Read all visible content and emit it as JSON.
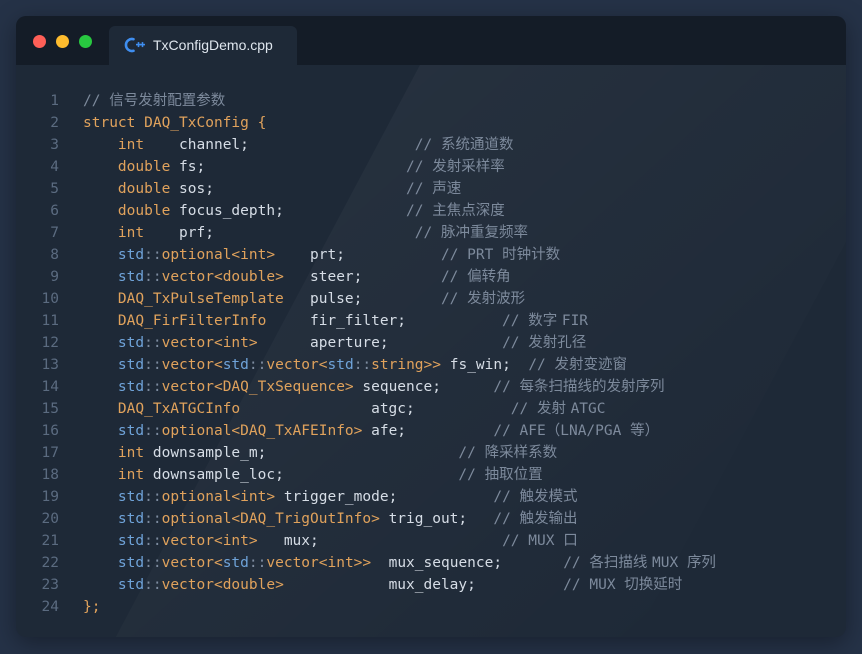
{
  "tab": {
    "filename": "TxConfigDemo.cpp",
    "icon": "cpp-file-icon"
  },
  "window_controls": [
    "close",
    "minimize",
    "maximize"
  ],
  "colors": {
    "keyword": "#e0a25c",
    "namespace": "#6fa3d9",
    "comment": "#7d8a9c",
    "text": "#d6dde6",
    "background": "#1e2937"
  },
  "lines": [
    {
      "n": "1",
      "tokens": [
        [
          "c",
          "// "
        ],
        [
          "cn",
          "信号发射配置参数"
        ]
      ]
    },
    {
      "n": "2",
      "tokens": [
        [
          "k",
          "struct DAQ_TxConfig {"
        ]
      ]
    },
    {
      "n": "3",
      "tokens": [
        [
          "x",
          "    "
        ],
        [
          "k",
          "int"
        ],
        [
          "x",
          "    channel;                   "
        ],
        [
          "c",
          "// "
        ],
        [
          "cn",
          "系统通道数"
        ]
      ]
    },
    {
      "n": "4",
      "tokens": [
        [
          "x",
          "    "
        ],
        [
          "k",
          "double"
        ],
        [
          "x",
          " fs;                       "
        ],
        [
          "c",
          "// "
        ],
        [
          "cn",
          "发射采样率"
        ]
      ]
    },
    {
      "n": "5",
      "tokens": [
        [
          "x",
          "    "
        ],
        [
          "k",
          "double"
        ],
        [
          "x",
          " sos;                      "
        ],
        [
          "c",
          "// "
        ],
        [
          "cn",
          "声速"
        ]
      ]
    },
    {
      "n": "6",
      "tokens": [
        [
          "x",
          "    "
        ],
        [
          "k",
          "double"
        ],
        [
          "x",
          " focus_depth;              "
        ],
        [
          "c",
          "// "
        ],
        [
          "cn",
          "主焦点深度"
        ]
      ]
    },
    {
      "n": "7",
      "tokens": [
        [
          "x",
          "    "
        ],
        [
          "k",
          "int"
        ],
        [
          "x",
          "    prf;                       "
        ],
        [
          "c",
          "// "
        ],
        [
          "cn",
          "脉冲重复频率"
        ]
      ]
    },
    {
      "n": "8",
      "tokens": [
        [
          "x",
          "    "
        ],
        [
          "ns",
          "std"
        ],
        [
          "p",
          "::"
        ],
        [
          "k",
          "optional<int>"
        ],
        [
          "x",
          "    prt;           "
        ],
        [
          "c",
          "// "
        ],
        [
          "c",
          "PRT "
        ],
        [
          "cn",
          "时钟计数"
        ]
      ]
    },
    {
      "n": "9",
      "tokens": [
        [
          "x",
          "    "
        ],
        [
          "ns",
          "std"
        ],
        [
          "p",
          "::"
        ],
        [
          "k",
          "vector<double>"
        ],
        [
          "x",
          "   steer;         "
        ],
        [
          "c",
          "// "
        ],
        [
          "cn",
          "偏转角"
        ]
      ]
    },
    {
      "n": "10",
      "tokens": [
        [
          "x",
          "    "
        ],
        [
          "k",
          "DAQ_TxPulseTemplate"
        ],
        [
          "x",
          "   pulse;         "
        ],
        [
          "c",
          "// "
        ],
        [
          "cn",
          "发射波形"
        ]
      ]
    },
    {
      "n": "11",
      "tokens": [
        [
          "x",
          "    "
        ],
        [
          "k",
          "DAQ_FirFilterInfo"
        ],
        [
          "x",
          "     fir_filter;           "
        ],
        [
          "c",
          "// "
        ],
        [
          "cn",
          "数字 "
        ],
        [
          "c",
          "FIR"
        ]
      ]
    },
    {
      "n": "12",
      "tokens": [
        [
          "x",
          "    "
        ],
        [
          "ns",
          "std"
        ],
        [
          "p",
          "::"
        ],
        [
          "k",
          "vector<int>"
        ],
        [
          "x",
          "      aperture;             "
        ],
        [
          "c",
          "// "
        ],
        [
          "cn",
          "发射孔径"
        ]
      ]
    },
    {
      "n": "13",
      "tokens": [
        [
          "x",
          "    "
        ],
        [
          "ns",
          "std"
        ],
        [
          "p",
          "::"
        ],
        [
          "k",
          "vector<"
        ],
        [
          "ns",
          "std"
        ],
        [
          "p",
          "::"
        ],
        [
          "k",
          "vector<"
        ],
        [
          "ns",
          "std"
        ],
        [
          "p",
          "::"
        ],
        [
          "k",
          "string>>"
        ],
        [
          "x",
          " fs_win;  "
        ],
        [
          "c",
          "// "
        ],
        [
          "cn",
          "发射变迹窗"
        ]
      ]
    },
    {
      "n": "14",
      "tokens": [
        [
          "x",
          "    "
        ],
        [
          "ns",
          "std"
        ],
        [
          "p",
          "::"
        ],
        [
          "k",
          "vector<DAQ_TxSequence>"
        ],
        [
          "x",
          " sequence;      "
        ],
        [
          "c",
          "// "
        ],
        [
          "cn",
          "每条扫描线的发射序列"
        ]
      ]
    },
    {
      "n": "15",
      "tokens": [
        [
          "x",
          "    "
        ],
        [
          "k",
          "DAQ_TxATGCInfo"
        ],
        [
          "x",
          "               atgc;           "
        ],
        [
          "c",
          "// "
        ],
        [
          "cn",
          "发射 "
        ],
        [
          "c",
          "ATGC"
        ]
      ]
    },
    {
      "n": "16",
      "tokens": [
        [
          "x",
          "    "
        ],
        [
          "ns",
          "std"
        ],
        [
          "p",
          "::"
        ],
        [
          "k",
          "optional<DAQ_TxAFEInfo>"
        ],
        [
          "x",
          " afe;          "
        ],
        [
          "c",
          "// "
        ],
        [
          "c",
          "AFE（LNA/PGA "
        ],
        [
          "cn",
          "等）"
        ]
      ]
    },
    {
      "n": "17",
      "tokens": [
        [
          "x",
          "    "
        ],
        [
          "k",
          "int"
        ],
        [
          "x",
          " downsample_m;                      "
        ],
        [
          "c",
          "// "
        ],
        [
          "cn",
          "降采样系数"
        ]
      ]
    },
    {
      "n": "18",
      "tokens": [
        [
          "x",
          "    "
        ],
        [
          "k",
          "int"
        ],
        [
          "x",
          " downsample_loc;                    "
        ],
        [
          "c",
          "// "
        ],
        [
          "cn",
          "抽取位置"
        ]
      ]
    },
    {
      "n": "19",
      "tokens": [
        [
          "x",
          "    "
        ],
        [
          "ns",
          "std"
        ],
        [
          "p",
          "::"
        ],
        [
          "k",
          "optional<int>"
        ],
        [
          "x",
          " trigger_mode;           "
        ],
        [
          "c",
          "// "
        ],
        [
          "cn",
          "触发模式"
        ]
      ]
    },
    {
      "n": "20",
      "tokens": [
        [
          "x",
          "    "
        ],
        [
          "ns",
          "std"
        ],
        [
          "p",
          "::"
        ],
        [
          "k",
          "optional<DAQ_TrigOutInfo>"
        ],
        [
          "x",
          " trig_out;   "
        ],
        [
          "c",
          "// "
        ],
        [
          "cn",
          "触发输出"
        ]
      ]
    },
    {
      "n": "21",
      "tokens": [
        [
          "x",
          "    "
        ],
        [
          "ns",
          "std"
        ],
        [
          "p",
          "::"
        ],
        [
          "k",
          "vector<int>"
        ],
        [
          "x",
          "   mux;                     "
        ],
        [
          "c",
          "// "
        ],
        [
          "c",
          "MUX "
        ],
        [
          "cn",
          "口"
        ]
      ]
    },
    {
      "n": "22",
      "tokens": [
        [
          "x",
          "    "
        ],
        [
          "ns",
          "std"
        ],
        [
          "p",
          "::"
        ],
        [
          "k",
          "vector<"
        ],
        [
          "ns",
          "std"
        ],
        [
          "p",
          "::"
        ],
        [
          "k",
          "vector<int>>"
        ],
        [
          "x",
          "  mux_sequence;       "
        ],
        [
          "c",
          "// "
        ],
        [
          "cn",
          "各扫描线 "
        ],
        [
          "c",
          "MUX "
        ],
        [
          "cn",
          "序列"
        ]
      ]
    },
    {
      "n": "23",
      "tokens": [
        [
          "x",
          "    "
        ],
        [
          "ns",
          "std"
        ],
        [
          "p",
          "::"
        ],
        [
          "k",
          "vector<double>"
        ],
        [
          "x",
          "            mux_delay;          "
        ],
        [
          "c",
          "// "
        ],
        [
          "c",
          "MUX "
        ],
        [
          "cn",
          "切换延时"
        ]
      ]
    },
    {
      "n": "24",
      "tokens": [
        [
          "k",
          "};"
        ]
      ]
    }
  ]
}
